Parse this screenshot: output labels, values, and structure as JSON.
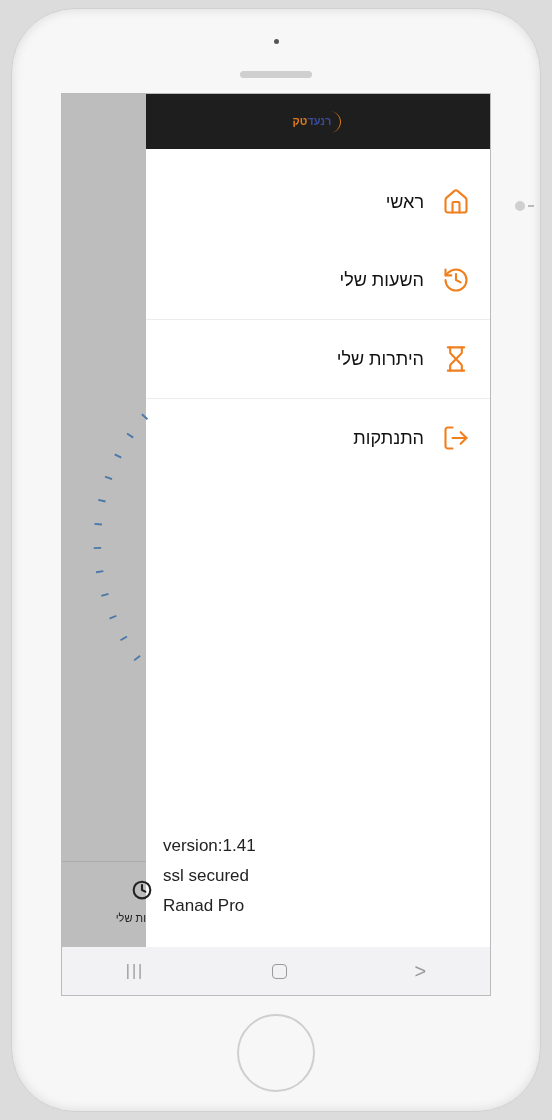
{
  "drawer": {
    "logo": {
      "part_1": "רנעד",
      "part_2": "טק"
    },
    "items": [
      {
        "kind": "home",
        "label": "ראשי",
        "divider_below": false
      },
      {
        "kind": "history",
        "label": "השעות שלי",
        "divider_below": true
      },
      {
        "kind": "hourglass",
        "label": "היתרות שלי",
        "divider_below": true
      },
      {
        "kind": "logout",
        "label": "התנתקות",
        "divider_below": false
      }
    ],
    "footer": [
      "version:1.41",
      "ssl secured",
      "Ranad Pro"
    ]
  },
  "background_tab": {
    "label": "ות שלי"
  },
  "nav_bar": {
    "recents_label": "|||",
    "back_label": ">"
  }
}
